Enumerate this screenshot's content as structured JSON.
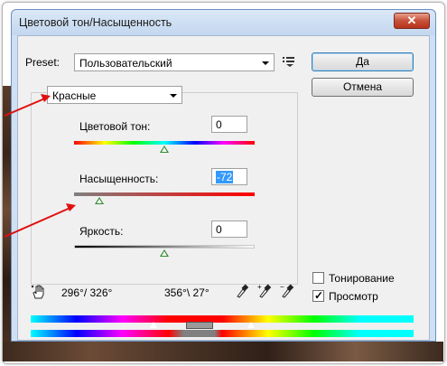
{
  "dialog": {
    "title": "Цветовой тон/Насыщенность",
    "close_label": "✕"
  },
  "preset": {
    "label": "Preset:",
    "value": "Пользовательский"
  },
  "buttons": {
    "ok_label": "Да",
    "cancel_label": "Отмена"
  },
  "channel": {
    "value": "Красные"
  },
  "hue": {
    "label": "Цветовой тон:",
    "value": "0",
    "fraction": 0.5
  },
  "saturation": {
    "label": "Насыщенность:",
    "value": "-72",
    "fraction": 0.14
  },
  "lightness": {
    "label": "Яркость:",
    "value": "0",
    "fraction": 0.5
  },
  "range": {
    "left_readout": "296°/ 326°",
    "right_readout": "356°\\ 27°"
  },
  "options": {
    "colorize_label": "Тонирование",
    "colorize_checked": false,
    "preview_label": "Просмотр",
    "preview_checked": true
  },
  "colors": {
    "accent": "#3399ff",
    "annotation_arrow": "#e01010",
    "title_bar": "#cfe0f5"
  }
}
